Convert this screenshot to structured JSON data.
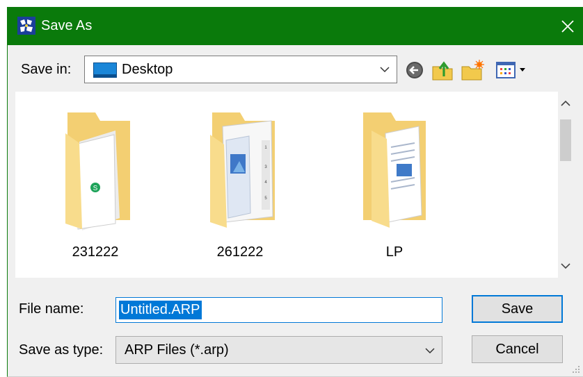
{
  "window": {
    "title": "Save As",
    "close_icon": "close-icon",
    "app_icon": "app-icon"
  },
  "toolbar": {
    "save_in_label": "Save in:",
    "location_value": "Desktop",
    "location_icon": "desktop-icon",
    "back_icon": "back-arrow-icon",
    "up_icon": "up-folder-icon",
    "new_folder_icon": "new-folder-icon",
    "view_menu_icon": "view-menu-icon"
  },
  "files": [
    {
      "name": "231222",
      "icon": "folder-icon"
    },
    {
      "name": "261222",
      "icon": "folder-icon"
    },
    {
      "name": "LP",
      "icon": "folder-icon"
    }
  ],
  "form": {
    "file_name_label": "File name:",
    "file_name_value": "Untitled.ARP",
    "save_as_type_label": "Save as type:",
    "save_as_type_value": "ARP Files (*.arp)"
  },
  "buttons": {
    "save": "Save",
    "cancel": "Cancel"
  },
  "colors": {
    "title_bar": "#0a7a0b",
    "accent": "#0078d7",
    "folder": "#f5d37a"
  }
}
